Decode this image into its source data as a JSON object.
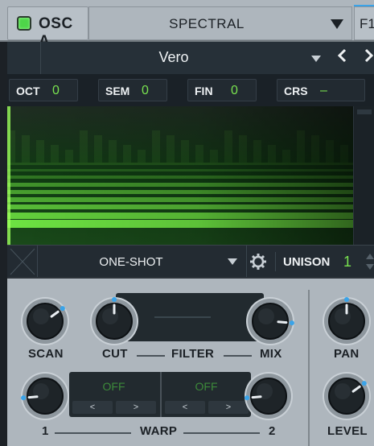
{
  "header": {
    "osc_title": "OSC A",
    "mode": "SPECTRAL",
    "filter_route": "F1",
    "power_on": true,
    "accent_color": "#3aa3e8",
    "power_color": "#4ed649"
  },
  "wavetable": {
    "name": "Vero",
    "prev_icon": "chevron-left-icon",
    "next_icon": "chevron-right-icon"
  },
  "pitch": {
    "oct": {
      "label": "OCT",
      "value": "0"
    },
    "sem": {
      "label": "SEM",
      "value": "0"
    },
    "fin": {
      "label": "FIN",
      "value": "0"
    },
    "crs": {
      "label": "CRS",
      "value": "–"
    }
  },
  "playback": {
    "mode": "ONE-SHOT",
    "unison_label": "UNISON",
    "unison_value": "1",
    "settings_icon": "gear-icon"
  },
  "knobs": {
    "scan": {
      "label": "SCAN",
      "value": 0.7
    },
    "cut": {
      "label": "CUT",
      "value": 0.5
    },
    "filter_label": "FILTER",
    "mix": {
      "label": "MIX",
      "value": 0.85
    },
    "pan": {
      "label": "PAN",
      "value": 0.5
    },
    "warp1": {
      "label": "1",
      "value": 0.15
    },
    "warp_label": "WARP",
    "warp2": {
      "label": "2",
      "value": 0.15
    },
    "level": {
      "label": "LEVEL",
      "value": 0.7
    }
  },
  "warp": {
    "slot1": {
      "value": "OFF",
      "prev": "<",
      "next": ">"
    },
    "slot2": {
      "value": "OFF",
      "prev": "<",
      "next": ">"
    }
  },
  "colors": {
    "value_green": "#79e24f",
    "knob_marker": "#3aa3e8",
    "spectrum_green": "#7dff4a"
  }
}
